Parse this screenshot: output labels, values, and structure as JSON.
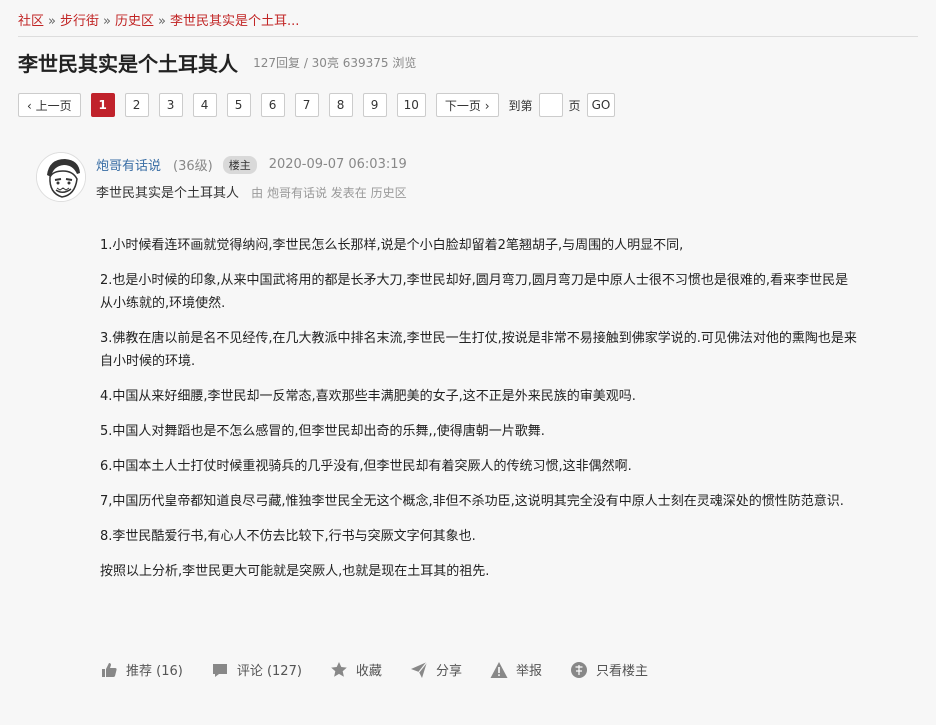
{
  "breadcrumb": {
    "items": [
      "社区",
      "步行街",
      "历史区",
      "李世民其实是个土耳..."
    ],
    "separator": "»"
  },
  "post": {
    "title": "李世民其实是个土耳其人",
    "stats": "127回复 / 30亮 639375 浏览"
  },
  "pager": {
    "prev": "‹ 上一页",
    "pages": [
      "1",
      "2",
      "3",
      "4",
      "5",
      "6",
      "7",
      "8",
      "9",
      "10"
    ],
    "current": "1",
    "next": "下一页 ›",
    "jump_prefix": "到第",
    "jump_suffix": "页",
    "go": "GO"
  },
  "author": {
    "name": "炮哥有话说",
    "level": "(36级)",
    "badge": "楼主",
    "time": "2020-09-07 06:03:19",
    "subtitle": "李世民其实是个土耳其人",
    "meta": "由  炮哥有话说 发表在  历史区"
  },
  "content": {
    "paragraphs": [
      "1.小时候看连环画就觉得纳闷,李世民怎么长那样,说是个小白脸却留着2笔翘胡子,与周围的人明显不同,",
      "2.也是小时候的印象,从来中国武将用的都是长矛大刀,李世民却好,圆月弯刀,圆月弯刀是中原人士很不习惯也是很难的,看来李世民是从小练就的,环境使然.",
      "3.佛教在唐以前是名不见经传,在几大教派中排名末流,李世民一生打仗,按说是非常不易接触到佛家学说的.可见佛法对他的熏陶也是来自小时候的环境.",
      "4.中国从来好细腰,李世民却一反常态,喜欢那些丰满肥美的女子,这不正是外来民族的审美观吗.",
      "5.中国人对舞蹈也是不怎么感冒的,但李世民却出奇的乐舞,,使得唐朝一片歌舞.",
      "6.中国本土人士打仗时候重视骑兵的几乎没有,但李世民却有着突厥人的传统习惯,这非偶然啊.",
      "7,中国历代皇帝都知道良尽弓藏,惟独李世民全无这个概念,非但不杀功臣,这说明其完全没有中原人士刻在灵魂深处的惯性防范意识.",
      "8.李世民酷爱行书,有心人不仿去比较下,行书与突厥文字何其象也.",
      "按照以上分析,李世民更大可能就是突厥人,也就是现在土耳其的祖先."
    ]
  },
  "actions": {
    "recommend": "推荐 (16)",
    "comment": "评论 (127)",
    "favorite": "收藏",
    "share": "分享",
    "report": "举报",
    "owner_only": "只看楼主"
  },
  "colors": {
    "accent": "#c0222b",
    "link": "#3a6ea5",
    "background": "#f7f7f7"
  }
}
